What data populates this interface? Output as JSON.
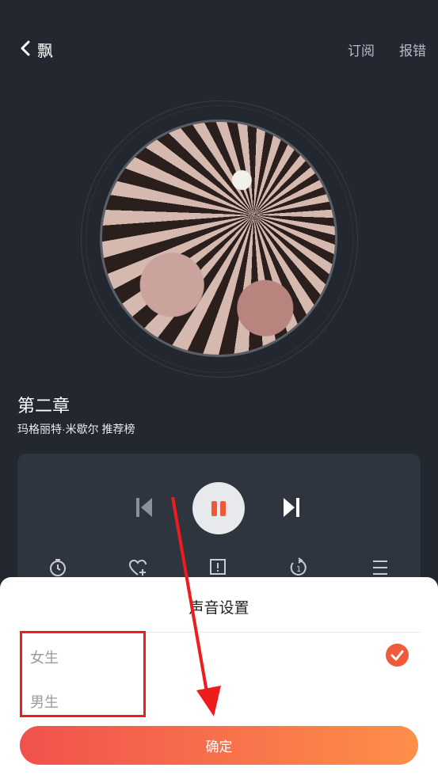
{
  "header": {
    "title": "飘",
    "subscribe_label": "订阅",
    "report_label": "报错"
  },
  "player": {
    "chapter": "第二章",
    "author_line": "玛格丽特·米歇尔 推荐榜",
    "state": "playing"
  },
  "toolbar": {
    "icons": [
      "timer-icon",
      "favorite-add-icon",
      "feedback-icon",
      "replay-icon",
      "playlist-icon"
    ]
  },
  "voice_sheet": {
    "title": "声音设置",
    "options": [
      {
        "label": "女生",
        "selected": true
      },
      {
        "label": "男生",
        "selected": false
      }
    ],
    "confirm_label": "确定"
  },
  "colors": {
    "background": "#222730",
    "panel": "#2f353f",
    "accent": "#f05a3a",
    "button_gradient_start": "#f0514c",
    "button_gradient_end": "#fe8f4a",
    "annotation_red": "#ee1c1c"
  }
}
